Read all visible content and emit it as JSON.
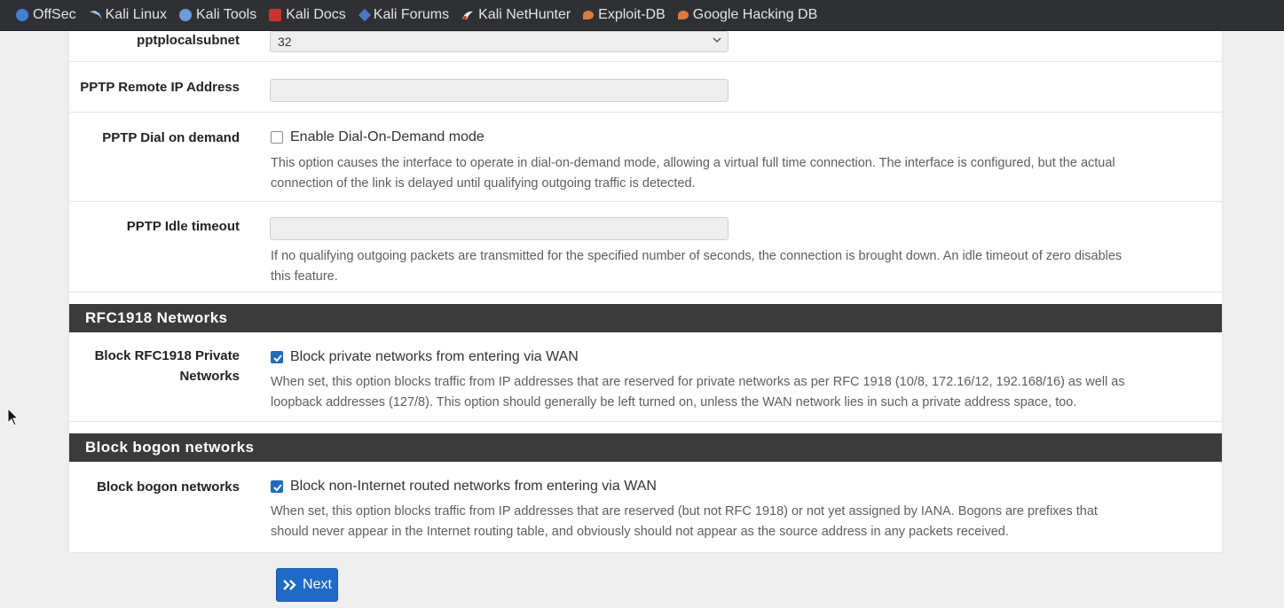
{
  "bookmarks": [
    {
      "label": "OffSec",
      "icon": "offsec-icon"
    },
    {
      "label": "Kali Linux",
      "icon": "kali-dragon-icon"
    },
    {
      "label": "Kali Tools",
      "icon": "kali-tools-icon"
    },
    {
      "label": "Kali Docs",
      "icon": "kali-docs-icon"
    },
    {
      "label": "Kali Forums",
      "icon": "kali-forums-icon"
    },
    {
      "label": "Kali NetHunter",
      "icon": "nethunter-icon"
    },
    {
      "label": "Exploit-DB",
      "icon": "exploit-db-icon"
    },
    {
      "label": "Google Hacking DB",
      "icon": "ghdb-icon"
    }
  ],
  "pptp": {
    "local_subnet_label": "pptplocalsubnet",
    "local_subnet_value": "32",
    "remote_ip_label": "PPTP Remote IP Address",
    "remote_ip_value": "",
    "dial_on_demand_label": "PPTP Dial on demand",
    "dial_on_demand_checkbox_label": "Enable Dial-On-Demand mode",
    "dial_on_demand_checked": false,
    "dial_on_demand_help_1": "This option causes the interface to operate in dial-on-demand mode, allowing a virtual full time connection. The interface is configured, but the actual",
    "dial_on_demand_help_2": "connection of the link is delayed until qualifying outgoing traffic is detected.",
    "idle_timeout_label": "PPTP Idle timeout",
    "idle_timeout_value": "",
    "idle_timeout_help_1": "If no qualifying outgoing packets are transmitted for the specified number of seconds, the connection is brought down. An idle timeout of zero disables",
    "idle_timeout_help_2": "this feature."
  },
  "rfc1918": {
    "section_title": "RFC1918 Networks",
    "label_line1": "Block RFC1918 Private",
    "label_line2": "Networks",
    "checkbox_label": "Block private networks from entering via WAN",
    "checked": true,
    "help_1": "When set, this option blocks traffic from IP addresses that are reserved for private networks as per RFC 1918 (10/8, 172.16/12, 192.168/16) as well as",
    "help_2": "loopback addresses (127/8). This option should generally be left turned on, unless the WAN network lies in such a private address space, too."
  },
  "bogon": {
    "section_title": "Block bogon networks",
    "label": "Block bogon networks",
    "checkbox_label": "Block non-Internet routed networks from entering via WAN",
    "checked": true,
    "help_1": "When set, this option blocks traffic from IP addresses that are reserved (but not RFC 1918) or not yet assigned by IANA. Bogons are prefixes that",
    "help_2": "should never appear in the Internet routing table, and obviously should not appear as the source address in any packets received."
  },
  "actions": {
    "next_label": "Next"
  },
  "colors": {
    "section_header_bg": "#3b3b3b",
    "primary_button": "#1e6ac8",
    "bookmarks_bar_bg": "#2f3034"
  }
}
